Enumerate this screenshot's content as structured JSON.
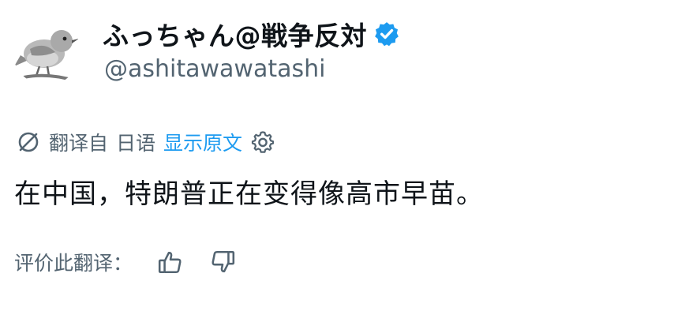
{
  "author": {
    "display_name": "ふっちゃん@戦争反対",
    "handle": "@ashitawawatashi",
    "avatar_icon": "bird-avatar-icon",
    "verified_icon": "verified-badge-icon",
    "verified_color": "#1d9bf0"
  },
  "translation": {
    "translated_from_label": "翻译自",
    "source_language": "日语",
    "show_original_label": "显示原文",
    "translate_icon": "translate-icon",
    "settings_icon": "settings-gear-icon"
  },
  "tweet": {
    "text": "在中国，特朗普正在变得像高市早苗。"
  },
  "rating": {
    "prompt": "评价此翻译：",
    "thumbs_up_icon": "thumbs-up-icon",
    "thumbs_down_icon": "thumbs-down-icon"
  },
  "colors": {
    "text_primary": "#0f1419",
    "text_secondary": "#536471",
    "link": "#1d9bf0"
  }
}
